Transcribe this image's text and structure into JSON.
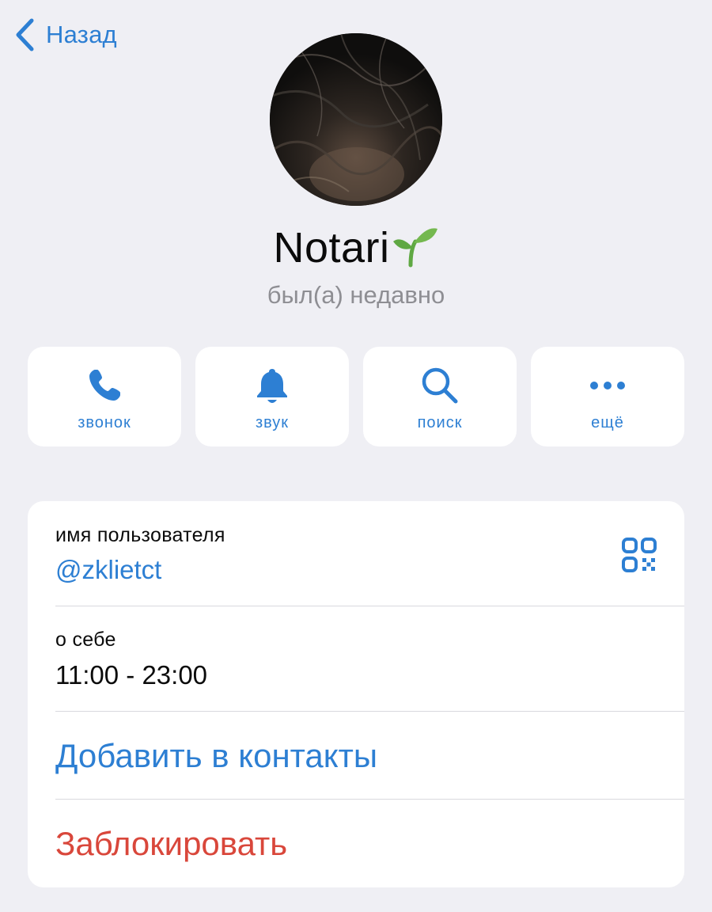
{
  "nav": {
    "back_label": "Назад"
  },
  "profile": {
    "name": "Notari",
    "name_emoji": "sprout",
    "status": "был(а) недавно"
  },
  "actions": [
    {
      "label": "звонок",
      "icon": "phone-icon"
    },
    {
      "label": "звук",
      "icon": "bell-icon"
    },
    {
      "label": "поиск",
      "icon": "search-icon"
    },
    {
      "label": "ещё",
      "icon": "more-icon"
    }
  ],
  "info": {
    "username_label": "имя пользователя",
    "username_value": "@zklietct",
    "bio_label": "о себе",
    "bio_value": "11:00 - 23:00",
    "add_contact": "Добавить в контакты",
    "block": "Заблокировать"
  },
  "colors": {
    "accent": "#2d7fd3",
    "destructive": "#d9473b",
    "background": "#efeff4",
    "secondary_text": "#8e8e93"
  }
}
